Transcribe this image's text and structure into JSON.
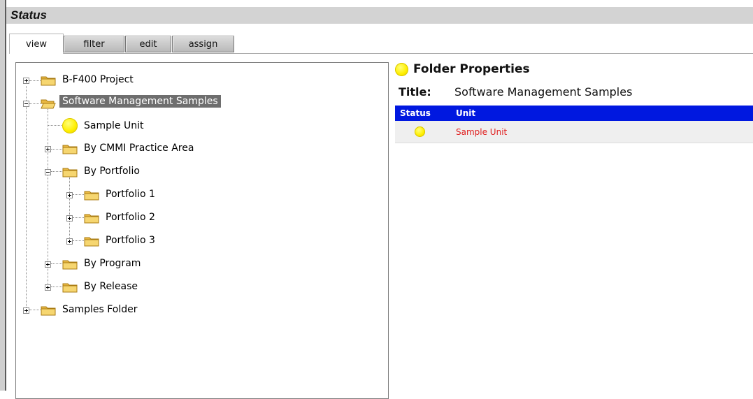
{
  "header": {
    "title": "Status"
  },
  "tabs": [
    {
      "label": "view",
      "active": true
    },
    {
      "label": "filter",
      "active": false
    },
    {
      "label": "edit",
      "active": false
    },
    {
      "label": "assign",
      "active": false
    }
  ],
  "tree": {
    "nodes": [
      {
        "label": "B-F400 Project",
        "icon": "folder-closed-icon",
        "expander": "plus",
        "selected": false
      },
      {
        "label": "Software Management Samples",
        "icon": "folder-open-icon",
        "expander": "minus",
        "selected": true
      },
      {
        "label": "Sample Unit",
        "icon": "yellow-status-icon"
      },
      {
        "label": "By CMMI Practice Area",
        "icon": "folder-closed-icon",
        "expander": "plus"
      },
      {
        "label": "By Portfolio",
        "icon": "folder-closed-icon",
        "expander": "minus"
      },
      {
        "label": "Portfolio 1",
        "icon": "folder-closed-icon",
        "expander": "plus"
      },
      {
        "label": "Portfolio 2",
        "icon": "folder-closed-icon",
        "expander": "plus"
      },
      {
        "label": "Portfolio 3",
        "icon": "folder-closed-icon",
        "expander": "plus"
      },
      {
        "label": "By Program",
        "icon": "folder-closed-icon",
        "expander": "plus"
      },
      {
        "label": "By Release",
        "icon": "folder-closed-icon",
        "expander": "plus"
      },
      {
        "label": "Samples Folder",
        "icon": "folder-closed-icon",
        "expander": "plus"
      }
    ]
  },
  "properties": {
    "heading": "Folder Properties",
    "title_label": "Title:",
    "title_value": "Software Management Samples",
    "table": {
      "headers": [
        "Status",
        "Unit"
      ],
      "rows": [
        {
          "status": "yellow-status-icon",
          "unit": "Sample Unit"
        }
      ]
    }
  },
  "colors": {
    "table_header": "#0018e0",
    "unit_link": "#e02020",
    "status_yellow": "#ffef00",
    "selected_bg": "#6e6e6e"
  }
}
